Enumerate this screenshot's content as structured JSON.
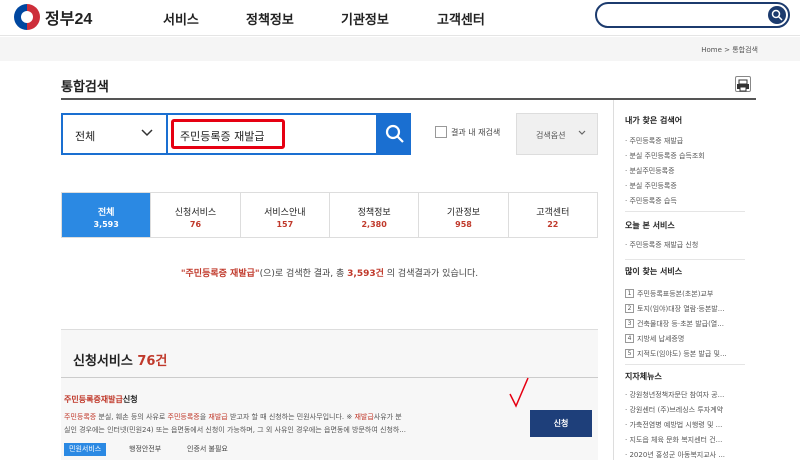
{
  "header": {
    "logo_text": "정부24",
    "nav": [
      "서비스",
      "정책정보",
      "기관정보",
      "고객센터"
    ],
    "search_value": ""
  },
  "breadcrumb": "Home  >  통합검색",
  "page_title": "통합검색",
  "search": {
    "scope": "전체",
    "query": "주민등록증 재발급",
    "research_label": "결과 내 재검색",
    "options_label": "검색옵션"
  },
  "tabs": [
    {
      "label": "전체",
      "count": "3,593",
      "active": true
    },
    {
      "label": "신청서비스",
      "count": "76"
    },
    {
      "label": "서비스안내",
      "count": "157"
    },
    {
      "label": "정책정보",
      "count": "2,380"
    },
    {
      "label": "기관정보",
      "count": "958"
    },
    {
      "label": "고객센터",
      "count": "22"
    }
  ],
  "summary": {
    "keyword": "\"주민등록증 재발급\"",
    "mid": "(으)로 검색한 결과, 총 ",
    "total": "3,593건",
    "tail": " 의 검색결과가 있습니다."
  },
  "section": {
    "title": "신청서비스",
    "count": "76건",
    "item": {
      "title_hl": "주민등록증재발급",
      "title_rest": "신청",
      "desc_line1_a": "주민등록증",
      "desc_line1_b": " 분실, 훼손 등의 사유로 ",
      "desc_line1_c": "주민등록증",
      "desc_line1_d": "을 ",
      "desc_line1_e": "재발급",
      "desc_line1_f": " 받고자 할 때 신청하는 민원사무입니다. ※ ",
      "desc_line1_g": "재발급",
      "desc_line1_h": "사유가 분",
      "desc_line2": "실인 경우에는 인터넷(민원24) 또는 읍면동에서 신청이 가능하며, 그 외 사유인 경우에는 읍면동에 방문하여 신청하...",
      "tag": "민원서비스",
      "org": "행정안전부",
      "cert": "인증서 불필요",
      "apply": "신청"
    }
  },
  "sidebar": {
    "my_searches_title": "내가 찾은 검색어",
    "my_searches": [
      "주민등록증 재발급",
      "분실 주민등록증 습득조회",
      "분실주민등록증",
      "분실 주민등록증",
      "주민등록증 습득"
    ],
    "viewed_title": "오늘 본 서비스",
    "viewed": [
      "주민등록증 재발급 신청"
    ],
    "popular_title": "많이 찾는 서비스",
    "popular": [
      {
        "no": "1",
        "label": "주민등록표등본(초본)교부"
      },
      {
        "no": "2",
        "label": "토지(임야)대장 열람·등본발..."
      },
      {
        "no": "3",
        "label": "건축물대장 등·초본 발급(열..."
      },
      {
        "no": "4",
        "label": "지방세 납세증명"
      },
      {
        "no": "5",
        "label": "지적도(임야도) 등본 발급 및..."
      }
    ],
    "news_title": "지자체뉴스",
    "news": [
      "강원청년정책자문단 참여자 공...",
      "강원센터 (주)브레싱스 투자계약",
      "가축전염병 예방법 시행령 및 ...",
      "지도읍 체육 문화 복지센터 건...",
      "2020년 홍성군 아동복지교사 ..."
    ]
  },
  "colors": {
    "accent": "#1a6fd1",
    "navy": "#1e3f7a",
    "highlight": "#c0392b",
    "query_box": "#e60012"
  }
}
